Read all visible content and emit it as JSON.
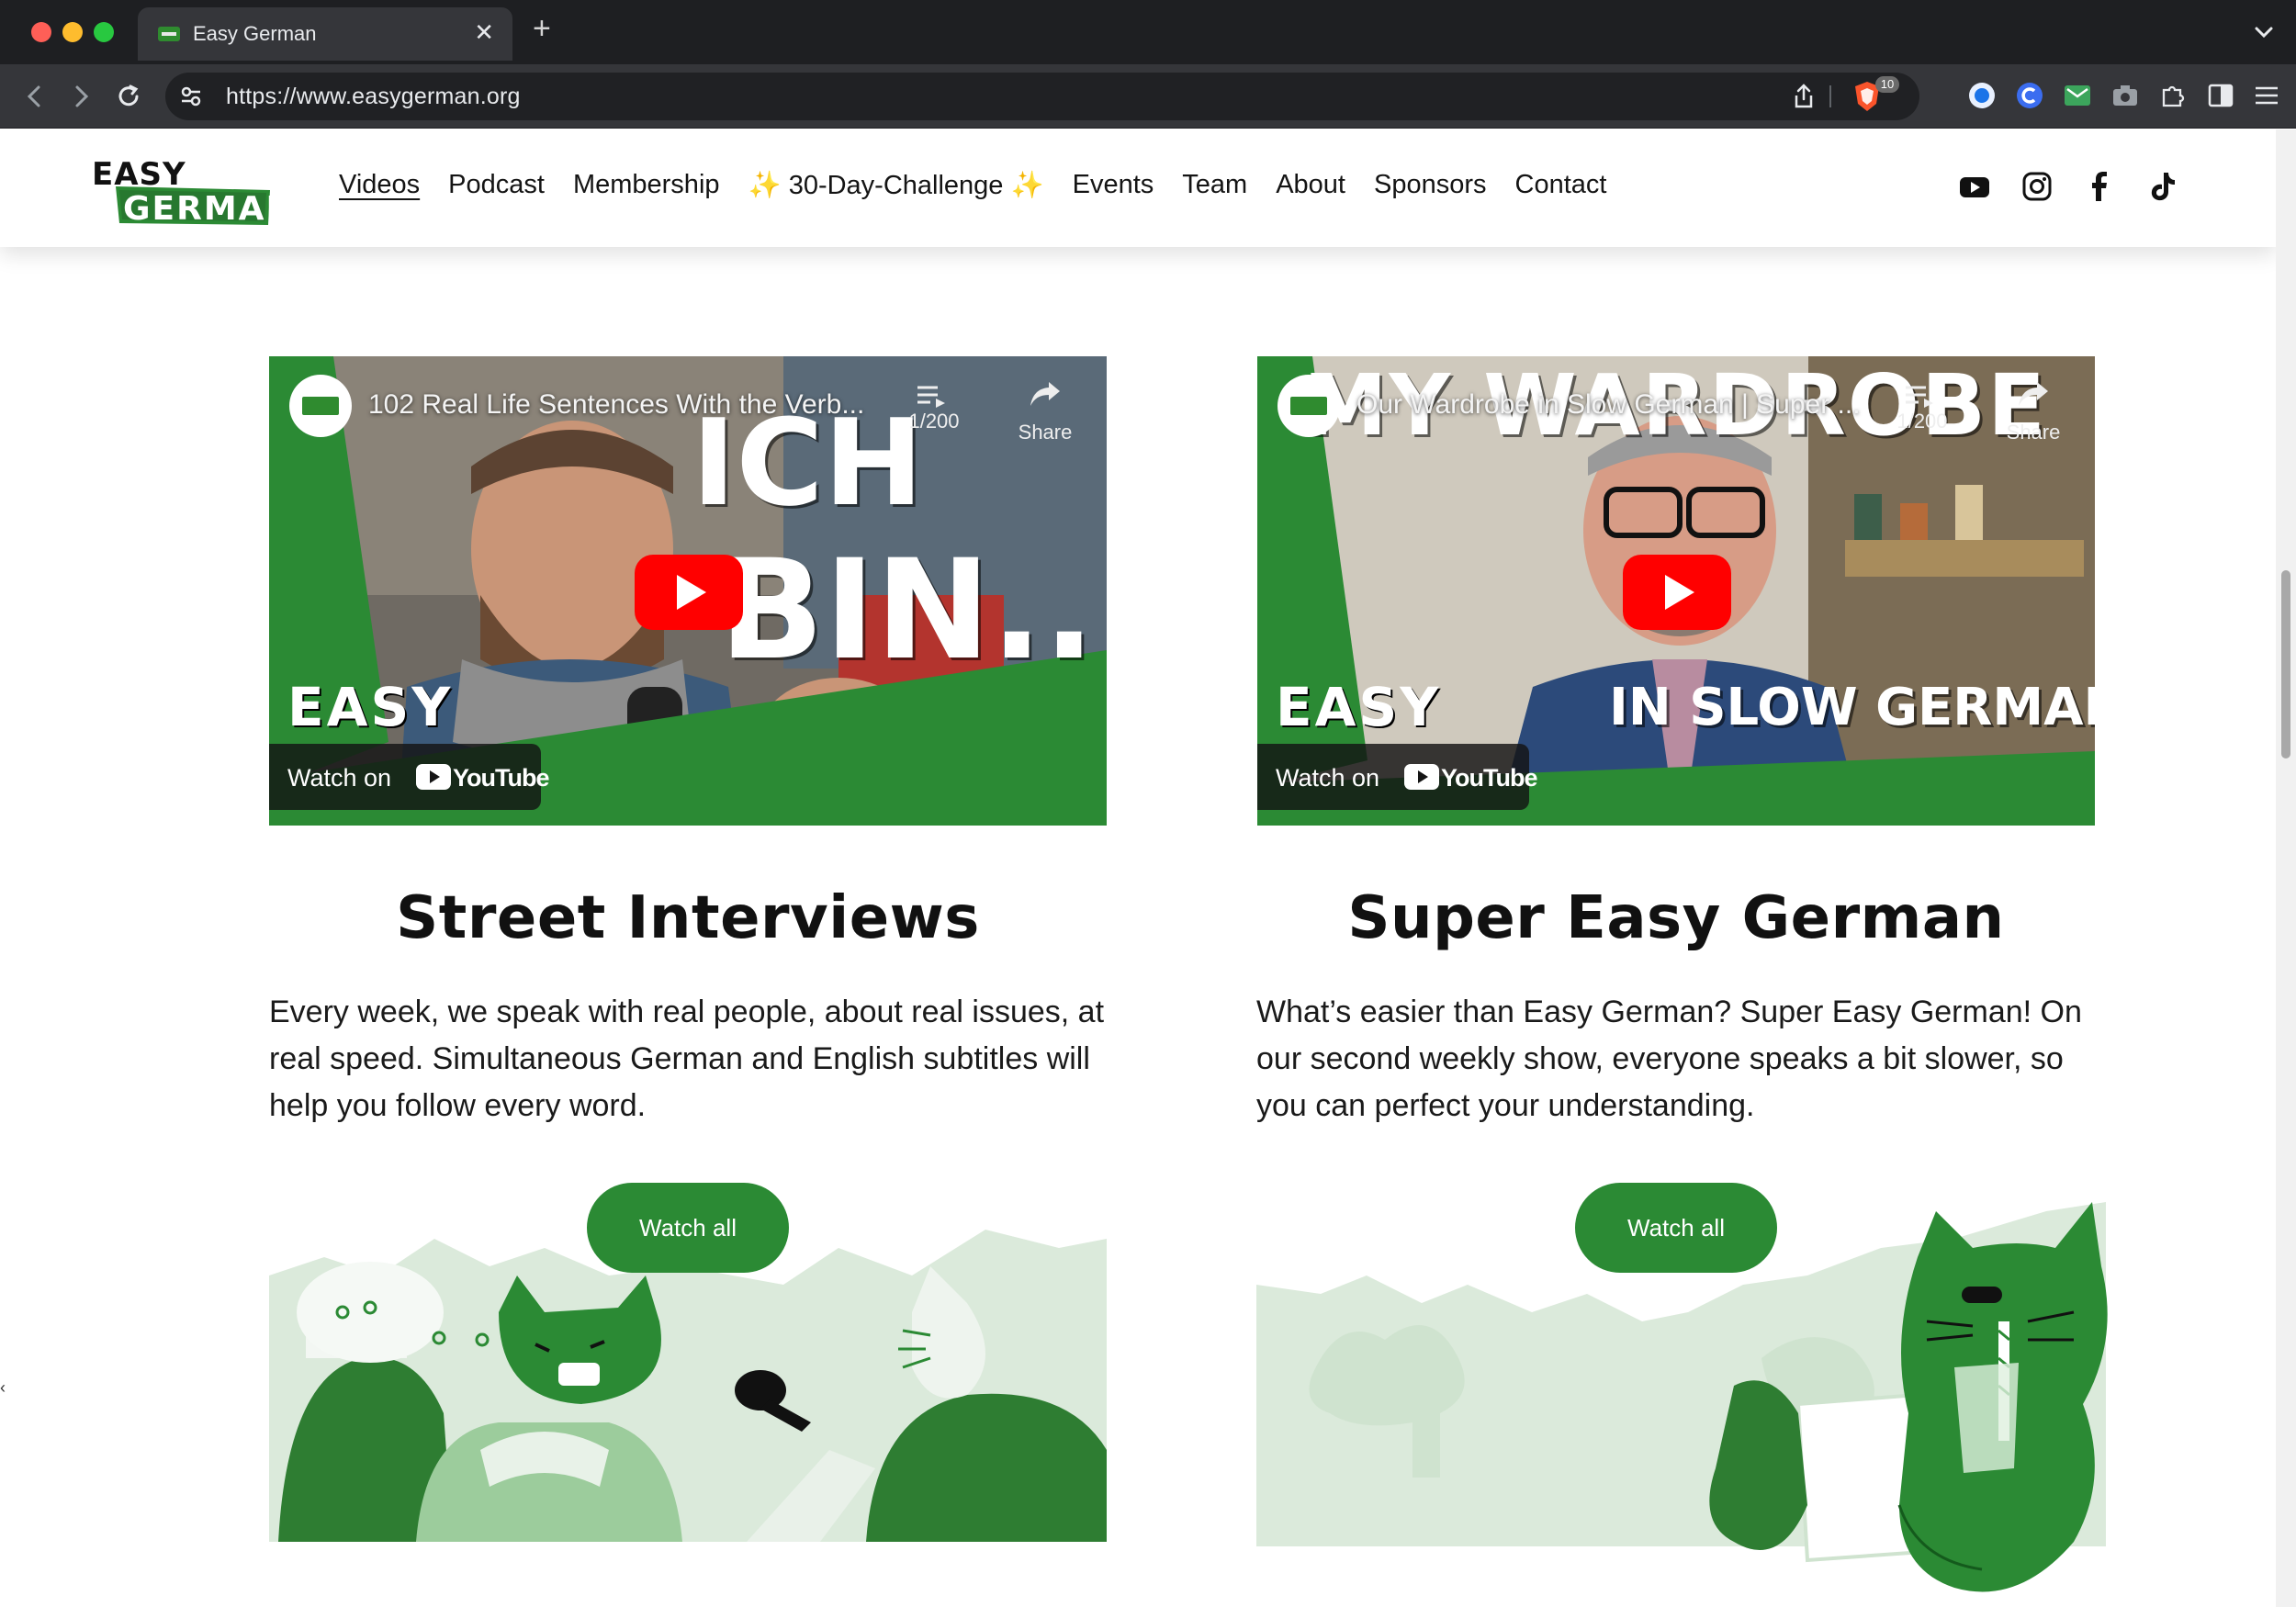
{
  "browser": {
    "tab_title": "Easy German",
    "url": "https://www.easygerman.org",
    "shield_badge": "10"
  },
  "header": {
    "logo_alt": "EASY GERMAN",
    "nav": [
      {
        "label": "Videos",
        "active": true
      },
      {
        "label": "Podcast"
      },
      {
        "label": "Membership"
      },
      {
        "label": "30-Day-Challenge",
        "sparkles": true
      },
      {
        "label": "Events"
      },
      {
        "label": "Team"
      },
      {
        "label": "About"
      },
      {
        "label": "Sponsors"
      },
      {
        "label": "Contact"
      }
    ],
    "social_icons": [
      "youtube-icon",
      "instagram-icon",
      "facebook-icon",
      "tiktok-icon"
    ]
  },
  "cards": [
    {
      "video": {
        "title": "102 Real Life Sentences With the Verb...",
        "playlist_count": "1/200",
        "share_label": "Share",
        "watch_on": "Watch on",
        "youtube": "YouTube",
        "thumb_text_1": "ICH",
        "thumb_text_2": "BIN...",
        "brand": "EASY"
      },
      "title": "Street Interviews",
      "text": "Every week, we speak with real people, about real issues, at real speed. Simultaneous German and English subtitles will help you follow every word.",
      "button": "Watch all"
    },
    {
      "video": {
        "title": "Our Wardrobe in Slow German | Super ...",
        "playlist_count": "1/200",
        "share_label": "Share",
        "watch_on": "Watch on",
        "youtube": "YouTube",
        "thumb_text_1": "MY WARDROBE",
        "thumb_text_2": "IN SLOW GERMAN",
        "brand": "EASY"
      },
      "title": "Super Easy German",
      "text": "What’s easier than Easy German? Super Easy German! On our second weekly show, everyone speaks a bit slower, so you can perfect your understanding.",
      "button": "Watch all"
    }
  ],
  "colors": {
    "brand_green": "#2b8a34",
    "illustration_light": "#dbeadb",
    "youtube_red": "#ff0000"
  }
}
